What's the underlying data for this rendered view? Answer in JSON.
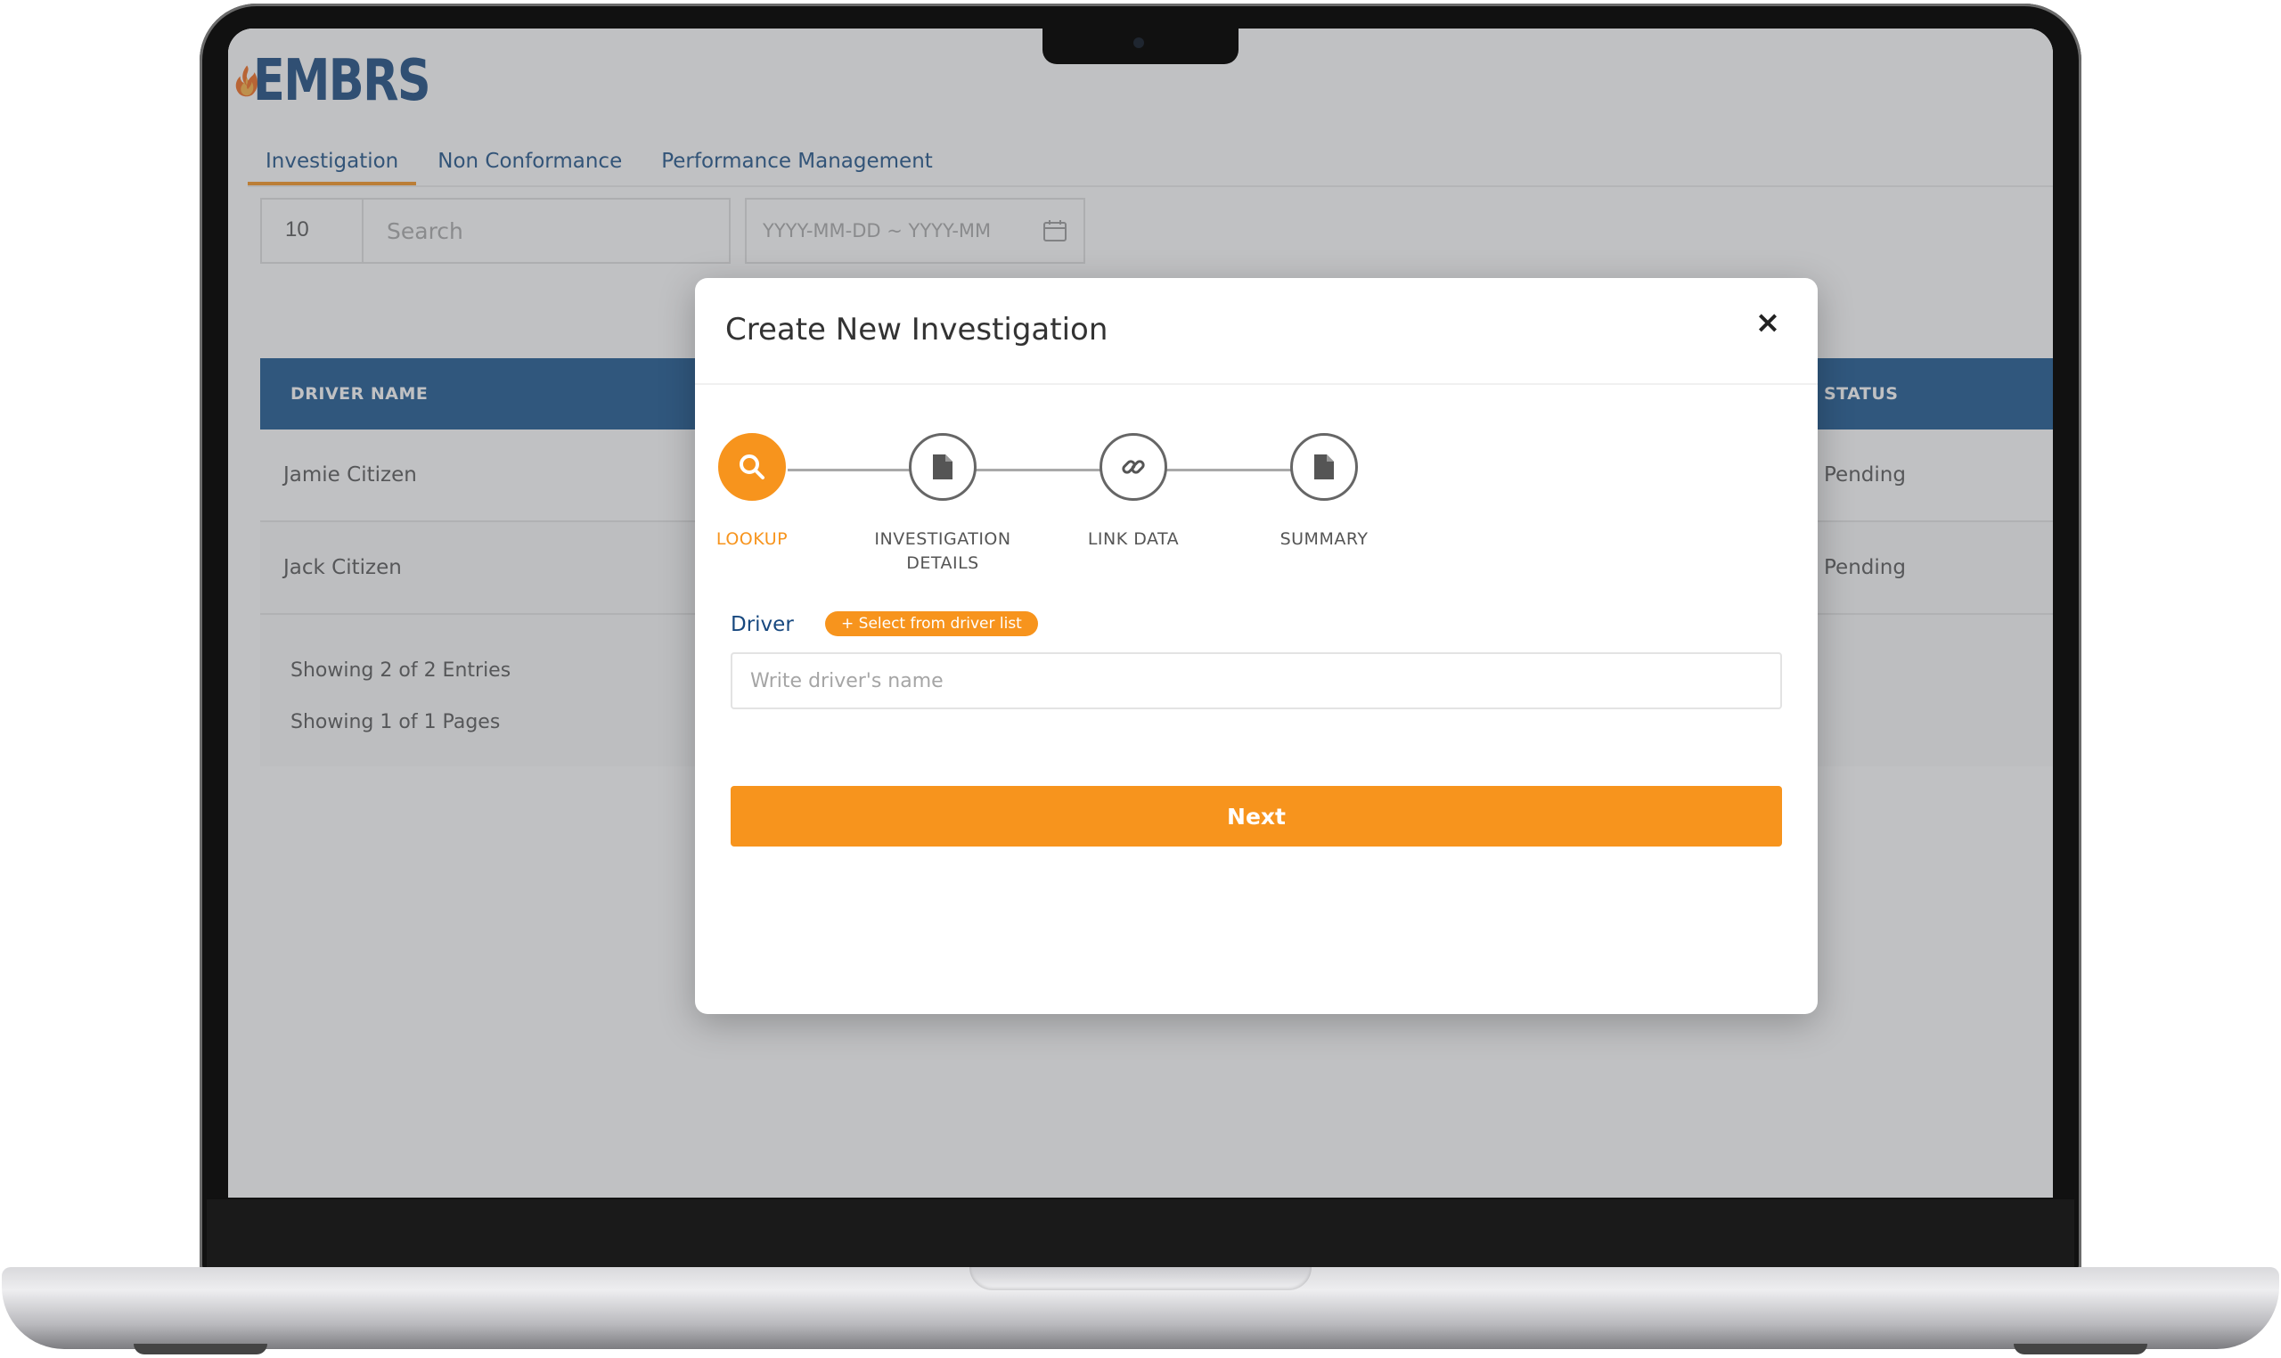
{
  "brand": {
    "name": "EMBRS",
    "primary_color": "#17487f",
    "accent_color": "#f7941d"
  },
  "tabs": [
    {
      "label": "Investigation",
      "active": true
    },
    {
      "label": "Non Conformance",
      "active": false
    },
    {
      "label": "Performance Management",
      "active": false
    }
  ],
  "filters": {
    "entries_value": "10",
    "search_placeholder": "Search",
    "date_placeholder": "YYYY-MM-DD ~ YYYY-MM"
  },
  "table": {
    "columns": {
      "driver": "DRIVER NAME",
      "status": "STATUS"
    },
    "rows": [
      {
        "driver": "Jamie Citizen",
        "status": "Pending"
      },
      {
        "driver": "Jack Citizen",
        "status": "Pending"
      }
    ],
    "footer": {
      "entries": "Showing 2 of 2 Entries",
      "pages": "Showing 1 of 1 Pages"
    }
  },
  "modal": {
    "title": "Create New Investigation",
    "close_symbol": "×",
    "steps": [
      {
        "label": "LOOKUP",
        "icon": "search-icon",
        "active": true
      },
      {
        "label": "INVESTIGATION\nDETAILS",
        "icon": "document-icon",
        "active": false
      },
      {
        "label": "LINK DATA",
        "icon": "link-icon",
        "active": false
      },
      {
        "label": "SUMMARY",
        "icon": "document-icon",
        "active": false
      }
    ],
    "driver_label": "Driver",
    "driver_badge": "+ Select from driver list",
    "driver_placeholder": "Write driver's name",
    "next_label": "Next"
  }
}
